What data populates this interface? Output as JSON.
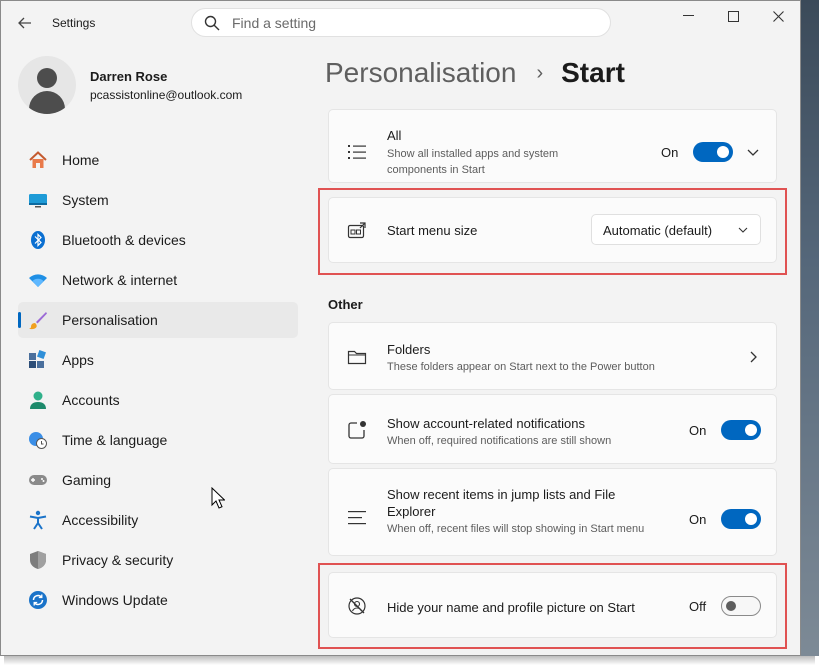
{
  "window": {
    "app_title": "Settings",
    "search_placeholder": "Find a setting",
    "controls": {
      "minimize": "—",
      "maximize": "☐",
      "close": "✕"
    }
  },
  "profile": {
    "name": "Darren Rose",
    "email": "pcassistonline@outlook.com"
  },
  "nav": {
    "items": [
      {
        "label": "Home",
        "icon": "home-icon"
      },
      {
        "label": "System",
        "icon": "system-icon"
      },
      {
        "label": "Bluetooth & devices",
        "icon": "bluetooth-icon"
      },
      {
        "label": "Network & internet",
        "icon": "network-icon"
      },
      {
        "label": "Personalisation",
        "icon": "brush-icon",
        "active": true
      },
      {
        "label": "Apps",
        "icon": "apps-icon"
      },
      {
        "label": "Accounts",
        "icon": "accounts-icon"
      },
      {
        "label": "Time & language",
        "icon": "globe-clock-icon"
      },
      {
        "label": "Gaming",
        "icon": "gamepad-icon"
      },
      {
        "label": "Accessibility",
        "icon": "accessibility-icon"
      },
      {
        "label": "Privacy & security",
        "icon": "shield-icon"
      },
      {
        "label": "Windows Update",
        "icon": "update-icon"
      }
    ]
  },
  "header": {
    "parent": "Personalisation",
    "separator": "›",
    "current": "Start"
  },
  "settings": {
    "all": {
      "title": "All",
      "description": "Show all installed apps and system components in Start",
      "state": "On"
    },
    "start_menu_size": {
      "title": "Start menu size",
      "value": "Automatic (default)"
    },
    "other_label": "Other",
    "folders": {
      "title": "Folders",
      "description": "These folders appear on Start next to the Power button"
    },
    "account_notifications": {
      "title": "Show account-related notifications",
      "description": "When off, required notifications are still shown",
      "state": "On"
    },
    "recent_items": {
      "title": "Show recent items in jump lists and File Explorer",
      "description": "When off, recent files will stop showing in Start menu",
      "state": "On"
    },
    "hide_profile": {
      "title": "Hide your name and profile picture on Start",
      "state": "Off"
    }
  },
  "colors": {
    "accent": "#0067c0",
    "highlight": "#e05252",
    "window_bg": "#f3f3f3",
    "card_bg": "#fbfbfb"
  }
}
